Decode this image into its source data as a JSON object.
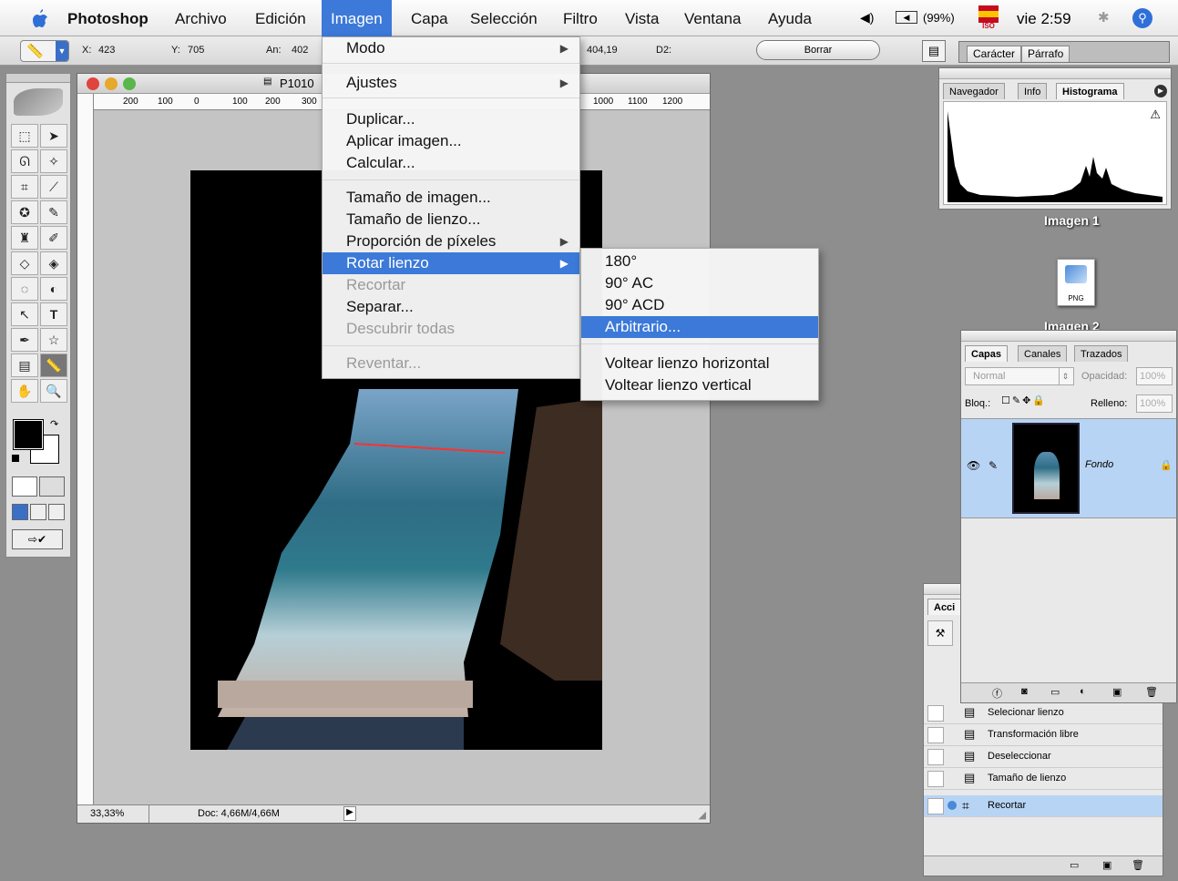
{
  "menubar": {
    "app": "Photoshop",
    "items": [
      "Archivo",
      "Edición",
      "Imagen",
      "Capa",
      "Selección",
      "Filtro",
      "Vista",
      "Ventana",
      "Ayuda"
    ],
    "battery": "(99%)",
    "flag_label": "ISO",
    "clock": "vie 2:59"
  },
  "options": {
    "x_label": "X:",
    "x_value": "423",
    "y_label": "Y:",
    "y_value": "705",
    "w_label": "An:",
    "w_value": "402",
    "d1_value": "404,19",
    "d2_label": "D2:",
    "clear_button": "Borrar",
    "tabs": [
      "Carácter",
      "Párrafo"
    ]
  },
  "document": {
    "title": "P1010",
    "ruler_h": [
      "200",
      "100",
      "0",
      "100",
      "200",
      "300",
      "1000",
      "1100",
      "1200"
    ],
    "zoom": "33,33%",
    "doc_size": "Doc: 4,66M/4,66M"
  },
  "imagen_menu": {
    "items": [
      {
        "label": "Modo",
        "submenu": true
      },
      {
        "label": "Ajustes",
        "submenu": true
      },
      {
        "label": "Duplicar..."
      },
      {
        "label": "Aplicar imagen..."
      },
      {
        "label": "Calcular..."
      },
      {
        "label": "Tamaño de imagen..."
      },
      {
        "label": "Tamaño de lienzo..."
      },
      {
        "label": "Proporción de píxeles",
        "submenu": true
      },
      {
        "label": "Rotar lienzo",
        "submenu": true
      },
      {
        "label": "Recortar",
        "disabled": true
      },
      {
        "label": "Separar..."
      },
      {
        "label": "Descubrir todas",
        "disabled": true
      },
      {
        "label": "Reventar...",
        "disabled": true
      }
    ]
  },
  "rotar_menu": {
    "items": [
      "180°",
      "90° AC",
      "90° ACD",
      "Arbitrario...",
      "Voltear lienzo horizontal",
      "Voltear lienzo vertical"
    ]
  },
  "histogram": {
    "tabs": [
      "Navegador",
      "Info",
      "Histograma"
    ]
  },
  "desktop": {
    "imagen1": "Imagen 1",
    "imagen2": "Imagen 2",
    "png_label": "PNG"
  },
  "layers": {
    "tabs": [
      "Capas",
      "Canales",
      "Trazados"
    ],
    "blend_mode": "Normal",
    "opacity_label": "Opacidad:",
    "opacity_value": "100%",
    "lock_label": "Bloq.:",
    "fill_label": "Relleno:",
    "fill_value": "100%",
    "layer_name": "Fondo"
  },
  "actions": {
    "tab": "Acci",
    "items": [
      "Selecionar lienzo",
      "Transformación libre",
      "Deseleccionar",
      "Tamaño de lienzo",
      "Recortar"
    ]
  },
  "colors": {
    "highlight": "#3c79d8",
    "desktop": "#8e8e8e"
  }
}
